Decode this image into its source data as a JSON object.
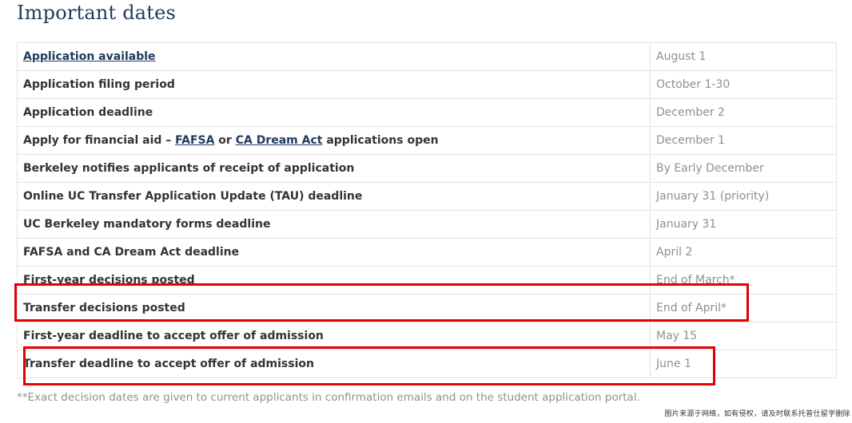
{
  "heading": "Important dates",
  "rows": [
    {
      "event": [
        {
          "t": "Application available",
          "link": true
        }
      ],
      "date": "August 1"
    },
    {
      "event": [
        {
          "t": "Application filing period"
        }
      ],
      "date": "October 1-30"
    },
    {
      "event": [
        {
          "t": "Application deadline"
        }
      ],
      "date": "December 2"
    },
    {
      "event": [
        {
          "t": "Apply for financial aid – "
        },
        {
          "t": "FAFSA",
          "link": true
        },
        {
          "t": " or "
        },
        {
          "t": "CA Dream Act",
          "link": true
        },
        {
          "t": " applications open"
        }
      ],
      "date": "December 1"
    },
    {
      "event": [
        {
          "t": "Berkeley notifies applicants of receipt of application"
        }
      ],
      "date": "By Early December"
    },
    {
      "event": [
        {
          "t": "Online UC Transfer Application Update (TAU) deadline"
        }
      ],
      "date": "January 31 (priority)"
    },
    {
      "event": [
        {
          "t": "UC Berkeley mandatory forms deadline"
        }
      ],
      "date": "January 31"
    },
    {
      "event": [
        {
          "t": "FAFSA and CA Dream Act deadline"
        }
      ],
      "date": "April 2"
    },
    {
      "event": [
        {
          "t": "First-year decisions posted"
        }
      ],
      "date": "End of March*"
    },
    {
      "event": [
        {
          "t": "Transfer decisions posted"
        }
      ],
      "date": "End of April*"
    },
    {
      "event": [
        {
          "t": "First-year deadline to accept offer of admission"
        }
      ],
      "date": "May 15"
    },
    {
      "event": [
        {
          "t": "Transfer deadline to accept offer of admission"
        }
      ],
      "date": "June 1"
    }
  ],
  "footnote": "**Exact decision dates are given to current applicants in confirmation emails and on the student application portal.",
  "credit": "图片来源于网络，如有侵权，请及时联系托普仕留学删除",
  "colors": {
    "heading": "#1f3a5f",
    "link": "#1f3a5f",
    "highlight": "#e60000",
    "date_text": "#8f8f8f"
  }
}
